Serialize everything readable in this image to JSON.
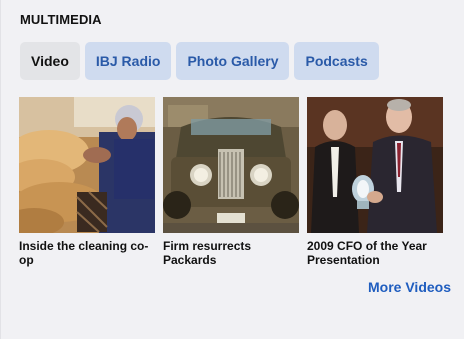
{
  "widget": {
    "title": "MULTIMEDIA",
    "tabs": [
      {
        "label": "Video",
        "active": true
      },
      {
        "label": "IBJ Radio",
        "active": false
      },
      {
        "label": "Photo Gallery",
        "active": false
      },
      {
        "label": "Podcasts",
        "active": false
      }
    ],
    "videos": [
      {
        "caption": "Inside the cleaning co-op"
      },
      {
        "caption": "Firm resurrects Packards"
      },
      {
        "caption": "2009 CFO of the Year Presentation"
      }
    ],
    "more_label": "More Videos"
  },
  "colors": {
    "panel_bg": "#f1f1f4",
    "tab_active_bg": "#e3e4e7",
    "tab_inactive_bg": "#cfdbef",
    "tab_inactive_text": "#2a5aa8",
    "link_color": "#1f5dbf"
  }
}
